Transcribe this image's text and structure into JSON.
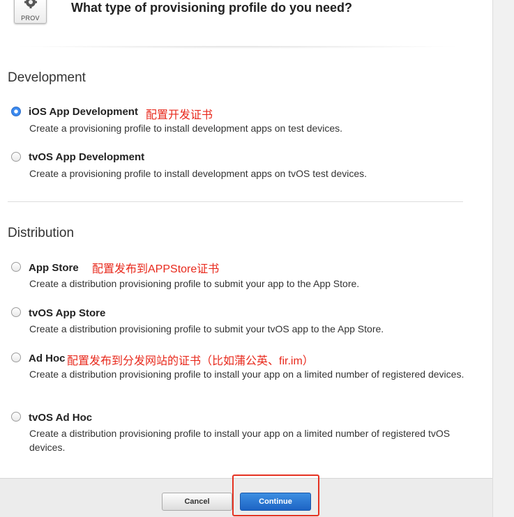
{
  "header": {
    "icon_label": "PROV",
    "title": "What type of provisioning profile do you need?"
  },
  "development": {
    "title": "Development",
    "options": [
      {
        "label": "iOS App Development",
        "description": "Create a provisioning profile to install development apps on test devices.",
        "annotation": "配置开发证书",
        "checked": true
      },
      {
        "label": "tvOS App Development",
        "description": "Create a provisioning profile to install development apps on tvOS test devices.",
        "checked": false
      }
    ]
  },
  "distribution": {
    "title": "Distribution",
    "options": [
      {
        "label": "App Store",
        "description": "Create a distribution provisioning profile to submit your app to the App Store.",
        "annotation": "配置发布到APPStore证书",
        "checked": false
      },
      {
        "label": "tvOS App Store",
        "description": "Create a distribution provisioning profile to submit your tvOS app to the App Store.",
        "checked": false
      },
      {
        "label": "Ad Hoc",
        "description": "Create a distribution provisioning profile to install your app on a limited number of registered devices.",
        "annotation": "配置发布到分发网站的证书（比如蒲公英、fir.im）",
        "checked": false
      },
      {
        "label": "tvOS Ad Hoc",
        "description": "Create a distribution provisioning profile to install your app on a limited number of registered tvOS devices.",
        "checked": false
      }
    ]
  },
  "footer": {
    "cancel_label": "Cancel",
    "continue_label": "Continue"
  },
  "colors": {
    "accent": "#2d6dc8",
    "annotation": "#e8291c",
    "primary_button": "#1d64c4"
  }
}
